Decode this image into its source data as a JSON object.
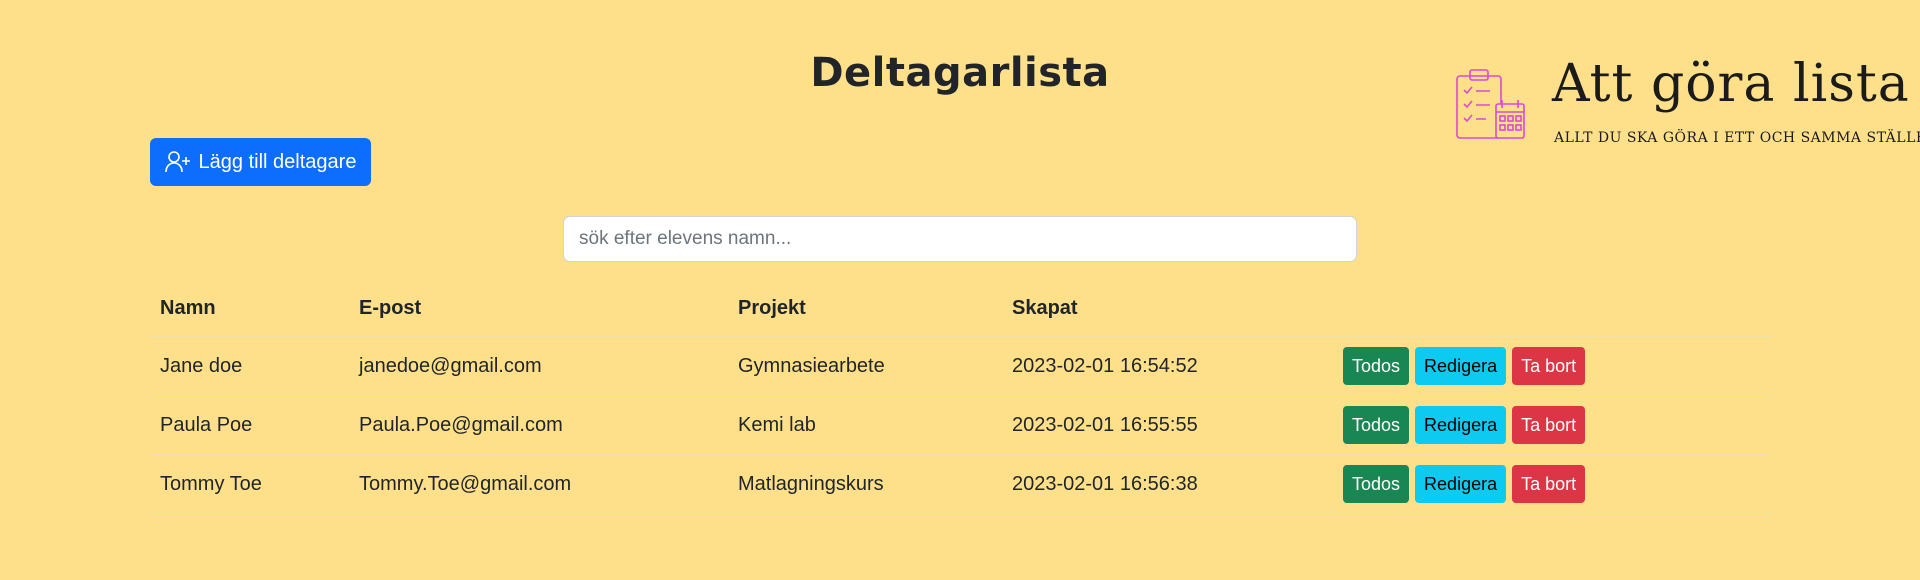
{
  "page": {
    "title": "Deltagarlista"
  },
  "logo": {
    "title": "Att göra lista",
    "tagline": "ALLT DU SKA GÖRA I ETT OCH SAMMA STÄLLE"
  },
  "toolbar": {
    "add_label": "Lägg till deltagare",
    "add_icon": "person-plus-icon"
  },
  "search": {
    "placeholder": "sök efter elevens namn...",
    "value": ""
  },
  "table": {
    "headers": [
      "Namn",
      "E-post",
      "Projekt",
      "Skapat"
    ],
    "rows": [
      {
        "name": "Jane doe",
        "email": "janedoe@gmail.com",
        "project": "Gymnasiearbete",
        "created": "2023-02-01 16:54:52"
      },
      {
        "name": "Paula Poe",
        "email": "Paula.Poe@gmail.com",
        "project": "Kemi lab",
        "created": "2023-02-01 16:55:55"
      },
      {
        "name": "Tommy Toe",
        "email": "Tommy.Toe@gmail.com",
        "project": "Matlagningskurs",
        "created": "2023-02-01 16:56:38"
      }
    ]
  },
  "actions": {
    "todos": "Todos",
    "edit": "Redigera",
    "delete": "Ta bort"
  },
  "colors": {
    "background": "#ffe08a",
    "primary": "#0d6efd",
    "success": "#198754",
    "info": "#0dcaf0",
    "danger": "#dc3545",
    "logo_accent": "#d94ad1"
  }
}
